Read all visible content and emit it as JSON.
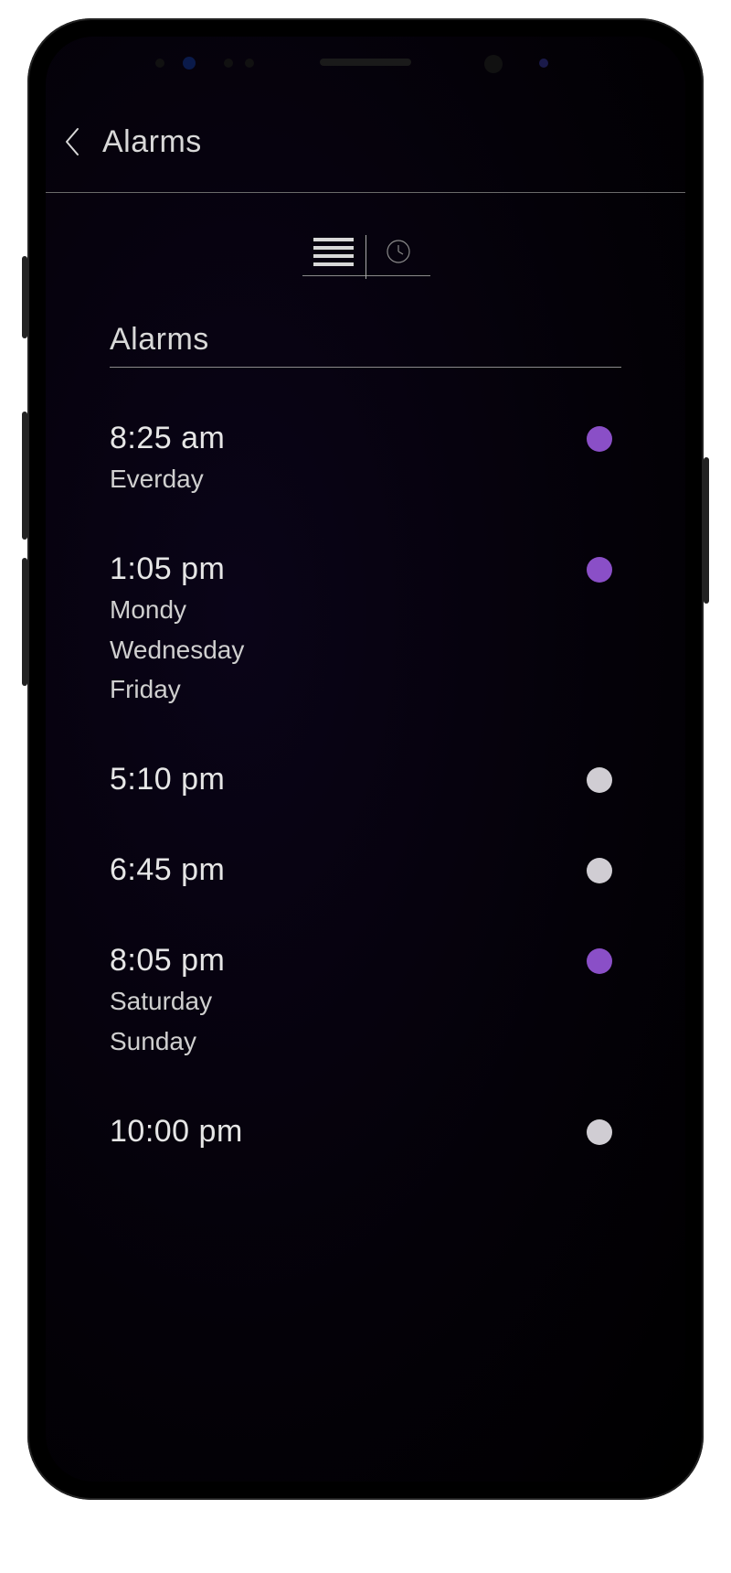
{
  "colors": {
    "accent": "#8a4fc7",
    "inactive": "#d0cdd3"
  },
  "header": {
    "title": "Alarms"
  },
  "section": {
    "title": "Alarms"
  },
  "alarms": [
    {
      "time": "8:25 am",
      "days": [
        "Everday"
      ],
      "active": true
    },
    {
      "time": "1:05 pm",
      "days": [
        "Mondy",
        "Wednesday",
        "Friday"
      ],
      "active": true
    },
    {
      "time": "5:10 pm",
      "days": [],
      "active": false
    },
    {
      "time": "6:45 pm",
      "days": [],
      "active": false
    },
    {
      "time": "8:05 pm",
      "days": [
        "Saturday",
        "Sunday"
      ],
      "active": true
    },
    {
      "time": "10:00 pm",
      "days": [],
      "active": false
    }
  ]
}
